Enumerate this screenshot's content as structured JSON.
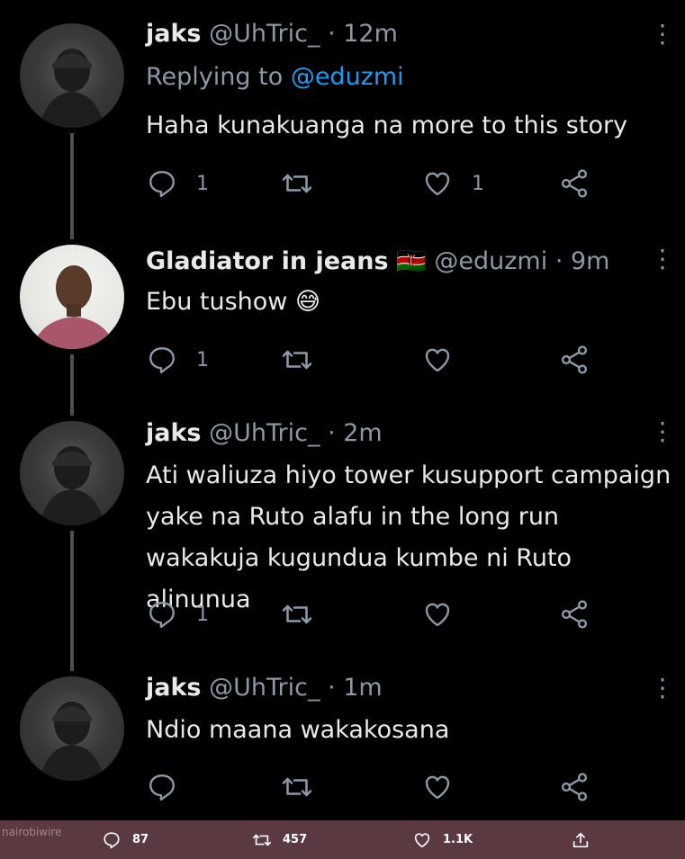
{
  "tweets": [
    {
      "name": "jaks",
      "handle": "@UhTric_",
      "time": "· 12m",
      "replying_prefix": "Replying to",
      "replying_to": "@eduzmi",
      "text": "Haha kunakuanga na more to this story",
      "reply_count": "1",
      "retweet_count": "",
      "like_count": "1"
    },
    {
      "name": "Gladiator in jeans",
      "flag": "🇰🇪",
      "handle": "@eduzmi",
      "time": "· 9m",
      "text": "Ebu tushow 😅",
      "reply_count": "1",
      "retweet_count": "",
      "like_count": ""
    },
    {
      "name": "jaks",
      "handle": "@UhTric_",
      "time": "· 2m",
      "text_lines": [
        "Ati waliuza hiyo tower kusupport campaign",
        "yake na Ruto alafu in the long run",
        "wakakuja kugundua kumbe ni Ruto alinunua"
      ],
      "reply_count": "1",
      "retweet_count": "",
      "like_count": ""
    },
    {
      "name": "jaks",
      "handle": "@UhTric_",
      "time": "· 1m",
      "text": "Ndio maana wakakosana",
      "reply_count": "",
      "retweet_count": "",
      "like_count": ""
    }
  ],
  "more_glyph": "⋮",
  "bottom_bar": {
    "watermark": "nairobiwire",
    "replies": "87",
    "retweets": "457",
    "likes": "1.1K"
  },
  "colors": {
    "background": "#000000",
    "accent": "#1d9bf0",
    "muted": "#8b98a5",
    "bottom_bar": "#5a3a40"
  },
  "icons": [
    "reply-icon",
    "retweet-icon",
    "like-icon",
    "share-icon",
    "more-icon",
    "upload-icon"
  ]
}
